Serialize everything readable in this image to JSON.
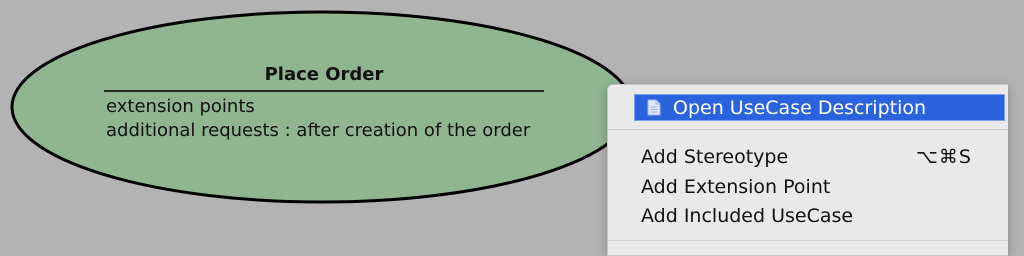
{
  "usecase": {
    "name": "Place Order",
    "extension_points_header": "extension points",
    "extension_points": [
      "additional requests : after creation of the order"
    ],
    "fill_color": "#90b591",
    "border_color": "#000000"
  },
  "context_menu": {
    "items": [
      {
        "label": "Open UseCase Description",
        "icon": "document-icon",
        "selected": true
      },
      {
        "label": "Add Stereotype",
        "shortcut": "⌥⌘S"
      },
      {
        "label": "Add Extension Point"
      },
      {
        "label": "Add Included UseCase"
      }
    ],
    "highlight_color": "#2b63df",
    "background_color": "#e9e9e9"
  },
  "canvas_background": "#b3b3b3"
}
